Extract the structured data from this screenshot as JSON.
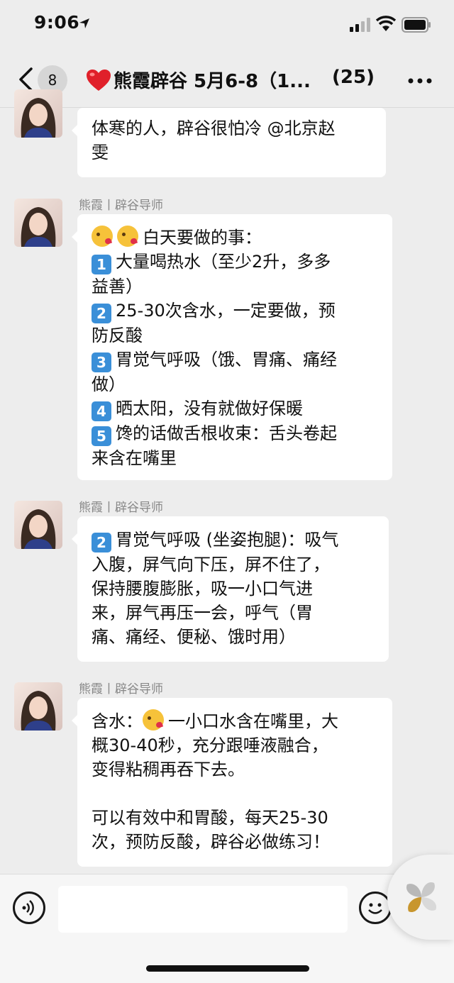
{
  "status_bar": {
    "time": "9:06"
  },
  "nav": {
    "unread_count": "8",
    "title": "熊霞辟谷 5月6-8（1...",
    "member_count": "(25)"
  },
  "messages": [
    {
      "sender": "",
      "lines": [
        "体寒的人，辟谷很怕冷 @北京赵",
        "雯"
      ]
    },
    {
      "sender": "熊霞丨辟谷导师",
      "title": "白天要做的事：",
      "lines": [
        "大量喝热水（至少2升，多多",
        "益善）",
        "25-30次含水，一定要做，预",
        "防反酸",
        "胃觉气呼吸（饿、胃痛、痛经",
        "做）",
        "晒太阳，没有就做好保暖",
        "馋的话做舌根收束：舌头卷起",
        "来含在嘴里"
      ],
      "numbers": [
        "1",
        "2",
        "3",
        "4",
        "5"
      ]
    },
    {
      "sender": "熊霞丨辟谷导师",
      "number": "2",
      "lines": [
        "胃觉气呼吸 (坐姿抱腿)：吸气",
        "入腹，屏气向下压，屏不住了，",
        "保持腰腹膨胀，吸一小口气进",
        "来，屏气再压一会，呼气（胃",
        "痛、痛经、便秘、饿时用）"
      ]
    },
    {
      "sender": "熊霞丨辟谷导师",
      "prefix": "含水：",
      "lines": [
        "一小口水含在嘴里，大",
        "概30-40秒，充分跟唾液融合，",
        "变得粘稠再吞下去。",
        "",
        "可以有效中和胃酸，每天25-30",
        "次，预防反酸，辟谷必做练习！"
      ]
    }
  ],
  "colors": {
    "background": "#ededed",
    "bubble": "#ffffff",
    "keycap": "#3a8fd8",
    "heart": "#e0202a"
  }
}
